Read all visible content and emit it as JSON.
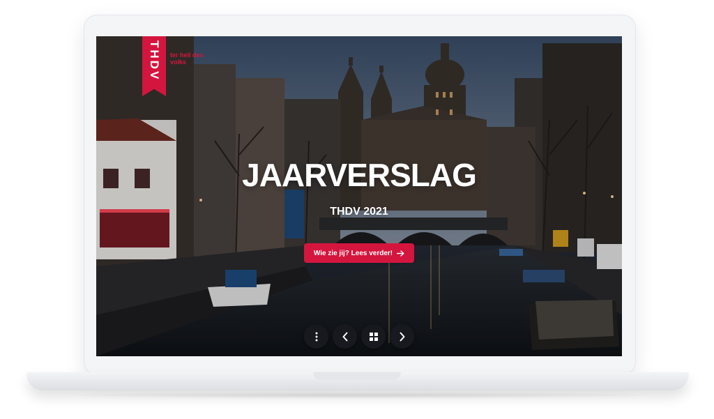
{
  "brand": {
    "logo_text": "THDV",
    "tagline": "ter heil des volks",
    "color": "#d4163e"
  },
  "hero": {
    "title": "JAARVERSLAG",
    "subtitle": "THDV 2021",
    "cta_label": "Wie zie jij? Lees verder!",
    "cta_icon": "arrow-right-icon"
  },
  "nav": {
    "buttons": [
      "menu-dots-icon",
      "chevron-left-icon",
      "grid-icon",
      "chevron-right-icon"
    ]
  },
  "colors": {
    "accent": "#d4163e",
    "nav_button": "#17191e",
    "text": "#ffffff"
  }
}
